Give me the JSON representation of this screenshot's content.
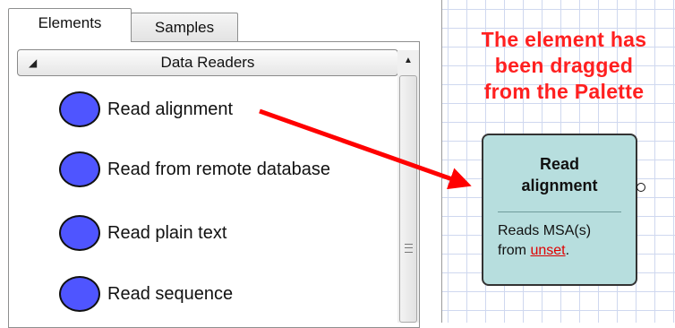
{
  "tabs": [
    {
      "label": "Elements",
      "active": true
    },
    {
      "label": "Samples",
      "active": false
    }
  ],
  "palette": {
    "group_label": "Data Readers",
    "items": [
      {
        "label": "Read alignment"
      },
      {
        "label": "Read from remote database"
      },
      {
        "label": "Read plain text"
      },
      {
        "label": "Read sequence"
      }
    ]
  },
  "canvas": {
    "note_lines": [
      "The element has",
      "been dragged",
      "from the Palette"
    ],
    "element": {
      "title_lines": [
        "Read",
        "alignment"
      ],
      "desc_prefix": "Reads MSA(s)",
      "desc_from": "from",
      "desc_link": "unset",
      "desc_suffix": "."
    }
  },
  "colors": {
    "note": "#ff2020",
    "arrow": "#ff0000",
    "element_fill": "#b7dede",
    "palette_dot": "#4f55ff"
  }
}
